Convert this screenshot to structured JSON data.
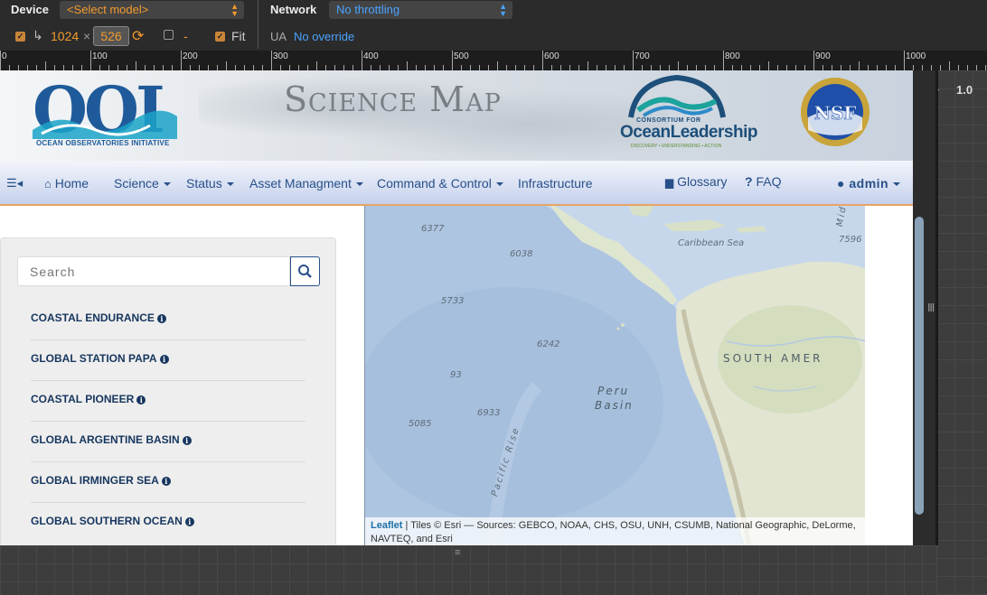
{
  "devtools": {
    "device_label": "Device",
    "device_select": "<Select model>",
    "network_label": "Network",
    "network_select": "No throttling",
    "width": "1024",
    "height": "526",
    "fit_label": "Fit",
    "dash": "-",
    "ua_label": "UA",
    "ua_value": "No override",
    "zoom": "1.0"
  },
  "ruler": {
    "ticks": [
      "0",
      "100",
      "200",
      "300",
      "400",
      "500",
      "600",
      "700",
      "800",
      "900",
      "1000"
    ]
  },
  "header": {
    "ooi_subtitle": "OCEAN OBSERVATORIES INITIATIVE",
    "science_map_S": "S",
    "science_map_cience": "CIENCE",
    "science_map_M": "M",
    "science_map_ap": "AP",
    "consortium_top": "CONSORTIUM FOR",
    "consortium_name": "OceanLeadership",
    "consortium_tagline": "DISCOVERY • UNDERSTANDING • ACTION",
    "nsf_text": "NSF"
  },
  "nav": {
    "home": "Home",
    "science": "Science",
    "status": "Status",
    "asset": "Asset Managment",
    "command": "Command & Control",
    "infrastructure": "Infrastructure",
    "glossary": "Glossary",
    "faq": "FAQ",
    "user": "admin"
  },
  "sidebar": {
    "search_placeholder": "Search",
    "sites": [
      {
        "label": "COASTAL ENDURANCE"
      },
      {
        "label": "GLOBAL STATION PAPA"
      },
      {
        "label": "COASTAL PIONEER"
      },
      {
        "label": "GLOBAL ARGENTINE BASIN"
      },
      {
        "label": "GLOBAL IRMINGER SEA"
      },
      {
        "label": "GLOBAL SOUTHERN OCEAN"
      }
    ]
  },
  "map": {
    "labels": {
      "d6377": "6377",
      "d6038": "6038",
      "d5733": "5733",
      "d6242": "6242",
      "d93": "93",
      "d6933": "6933",
      "d5085": "5085",
      "d7596": "7596",
      "caribbean": "Caribbean Sea",
      "peru": "Peru",
      "basin": "Basin",
      "south_america": "SOUTH AMER",
      "rise": "Pacific Rise",
      "mid": "Mid"
    },
    "attribution_leaflet": "Leaflet",
    "attribution_text": " | Tiles © Esri — Sources: GEBCO, NOAA, CHS, OSU, UNH, CSUMB, National Geographic, DeLorme, NAVTEQ, and Esri"
  }
}
